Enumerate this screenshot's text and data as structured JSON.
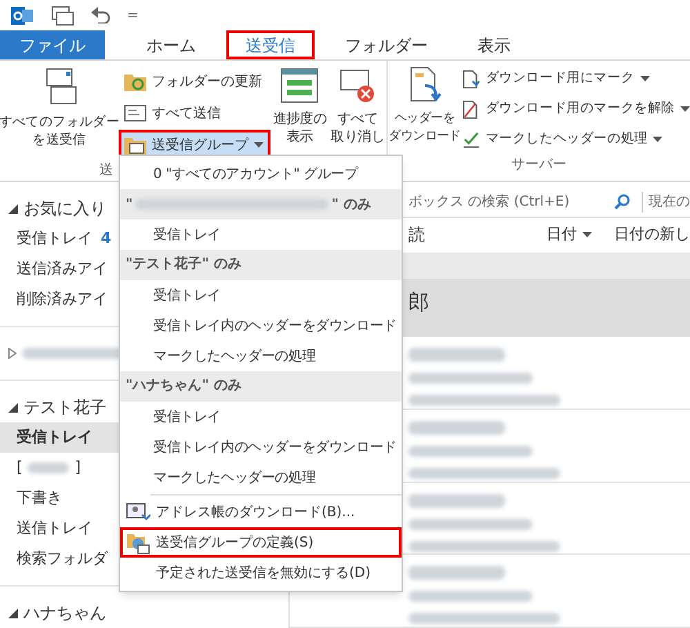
{
  "quick_access": {
    "overflow": "="
  },
  "tabs": [
    {
      "label": "ファイル",
      "kind": "file",
      "selected": false,
      "highlighted": false
    },
    {
      "label": "ホーム",
      "kind": "tab",
      "selected": false,
      "highlighted": false
    },
    {
      "label": "送受信",
      "kind": "tab",
      "selected": true,
      "highlighted": true
    },
    {
      "label": "フォルダー",
      "kind": "tab",
      "selected": false,
      "highlighted": false
    },
    {
      "label": "表示",
      "kind": "tab",
      "selected": false,
      "highlighted": false
    }
  ],
  "ribbon": {
    "send_all": {
      "lines": [
        "すべてのフォルダー",
        "を送受信"
      ]
    },
    "small_buttons": [
      {
        "label": "フォルダーの更新",
        "pressed": false,
        "highlighted": false,
        "dropdown": false
      },
      {
        "label": "すべて送信",
        "pressed": false,
        "highlighted": false,
        "dropdown": false
      },
      {
        "label": "送受信グループ",
        "pressed": true,
        "highlighted": true,
        "dropdown": true
      }
    ],
    "group_label": "送",
    "big_buttons": [
      {
        "lines": [
          "進捗度の",
          "表示"
        ]
      },
      {
        "lines": [
          "すべて",
          "取り消し"
        ]
      }
    ],
    "server": {
      "download_headers": {
        "lines": [
          "ヘッダーを",
          "ダウンロード"
        ]
      },
      "items": [
        {
          "label": "ダウンロード用にマーク"
        },
        {
          "label": "ダウンロード用のマークを解除"
        },
        {
          "label": "マークしたヘッダーの処理"
        }
      ],
      "group_label": "サーバー"
    }
  },
  "navigation": {
    "sections": [
      {
        "kind": "account",
        "title": "お気に入り",
        "expanded": true,
        "items": [
          {
            "kind": "folder",
            "label": "受信トレイ",
            "count": "4",
            "selected": false
          },
          {
            "kind": "folder",
            "label": "送信済みアイ",
            "selected": false
          },
          {
            "kind": "folder",
            "label": "削除済みアイ",
            "selected": false
          }
        ]
      },
      {
        "kind": "blurred",
        "expanded": false
      },
      {
        "kind": "account",
        "title": "テスト花子",
        "expanded": true,
        "items": [
          {
            "kind": "folder",
            "label": "受信トレイ",
            "selected": true
          },
          {
            "kind": "blurred",
            "label": "[",
            "suffix": "]",
            "selected": false
          },
          {
            "kind": "folder",
            "label": "下書き",
            "selected": false
          },
          {
            "kind": "folder",
            "label": "送信トレイ",
            "selected": false
          },
          {
            "kind": "folder",
            "label": "検索フォルダ",
            "selected": false
          }
        ]
      },
      {
        "kind": "account",
        "title": "ハナちゃん",
        "expanded": true
      }
    ]
  },
  "search": {
    "placeholder": "ボックス の検索 (Ctrl+E)",
    "scope": "現在の"
  },
  "message_list": {
    "column_1": "読",
    "sort": "日付",
    "order": "日付の新し",
    "rows": [
      {
        "kind": "group"
      },
      {
        "kind": "message",
        "selected": true,
        "sender": "郎"
      },
      {
        "kind": "message",
        "selected": false
      },
      {
        "kind": "message",
        "selected": false
      },
      {
        "kind": "message",
        "selected": false
      },
      {
        "kind": "message",
        "selected": false
      }
    ]
  },
  "menu": {
    "items": [
      {
        "kind": "item",
        "label": "0 \"すべてのアカウント\" グループ",
        "highlighted": false
      },
      {
        "kind": "header_blurred",
        "before": "\"",
        "after": "\" のみ"
      },
      {
        "kind": "item",
        "label": "受信トレイ",
        "highlighted": false
      },
      {
        "kind": "header",
        "label": "\"テスト花子\" のみ"
      },
      {
        "kind": "item",
        "label": "受信トレイ",
        "highlighted": false
      },
      {
        "kind": "item",
        "label": "受信トレイ内のヘッダーをダウンロード",
        "highlighted": false
      },
      {
        "kind": "item",
        "label": "マークしたヘッダーの処理",
        "highlighted": false
      },
      {
        "kind": "header",
        "label": "\"ハナちゃん\" のみ"
      },
      {
        "kind": "item",
        "label": "受信トレイ",
        "highlighted": false
      },
      {
        "kind": "item",
        "label": "受信トレイ内のヘッダーをダウンロード",
        "highlighted": false
      },
      {
        "kind": "item",
        "label": "マークしたヘッダーの処理",
        "highlighted": false
      },
      {
        "kind": "separator"
      },
      {
        "kind": "address_book",
        "label": "アドレス帳のダウンロード(B)...",
        "highlighted": false
      },
      {
        "kind": "define_groups",
        "label": "送受信グループの定義(S)",
        "highlighted": true
      },
      {
        "kind": "plain_command",
        "label": "予定された送受信を無効にする(D)",
        "highlighted": false
      }
    ]
  }
}
